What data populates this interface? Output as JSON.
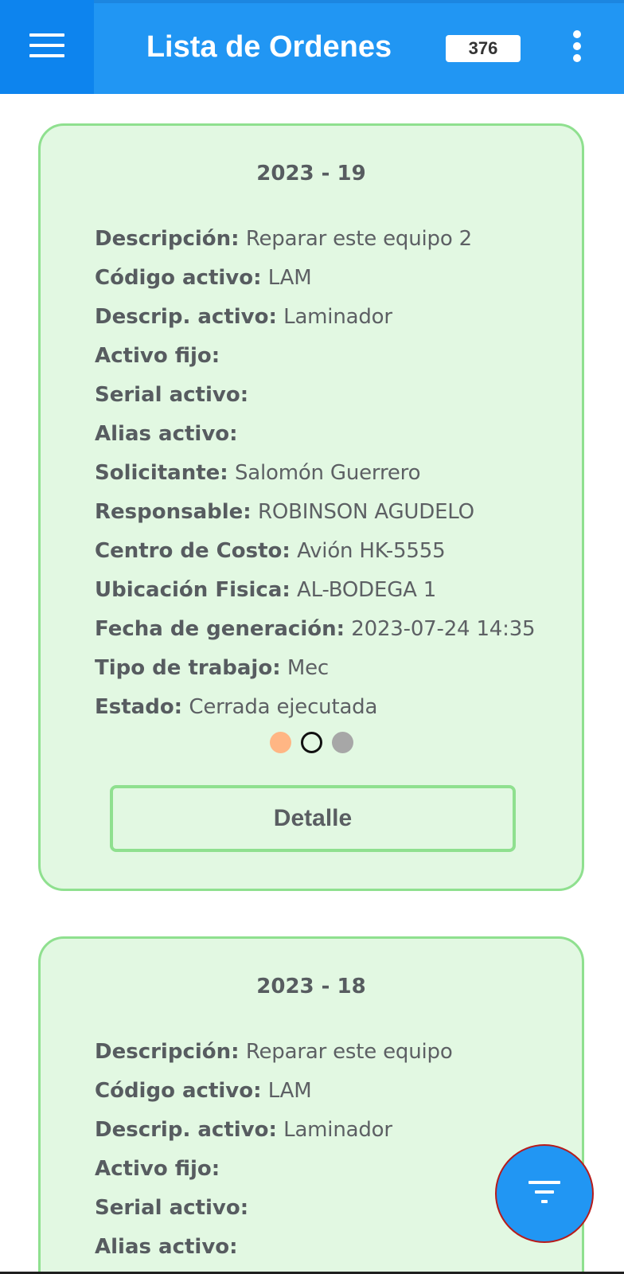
{
  "appbar": {
    "title": "Lista de Ordenes",
    "count": "376",
    "menu_icon": "hamburger-menu-icon",
    "more_icon": "more-vertical-icon",
    "color": "#2196f3"
  },
  "orders": [
    {
      "title": "2023 - 19",
      "fields": [
        {
          "label": "Descripción:",
          "value": "Reparar este equipo 2"
        },
        {
          "label": "Código activo:",
          "value": "LAM"
        },
        {
          "label": "Descrip. activo:",
          "value": "Laminador"
        },
        {
          "label": "Activo fijo:",
          "value": ""
        },
        {
          "label": "Serial activo:",
          "value": ""
        },
        {
          "label": "Alias activo:",
          "value": ""
        },
        {
          "label": "Solicitante:",
          "value": "Salomón Guerrero"
        },
        {
          "label": "Responsable:",
          "value": "ROBINSON AGUDELO"
        },
        {
          "label": "Centro de Costo:",
          "value": "Avión HK-5555"
        },
        {
          "label": "Ubicación Fisica:",
          "value": "AL-BODEGA 1"
        },
        {
          "label": "Fecha de generación:",
          "value": "2023-07-24 14:35"
        },
        {
          "label": "Tipo de trabajo:",
          "value": "Mec"
        },
        {
          "label": "Estado:",
          "value": "Cerrada ejecutada"
        }
      ],
      "status_dots": [
        "#ffb684",
        "outline",
        "#a7a7a7"
      ],
      "detail_label": "Detalle"
    },
    {
      "title": "2023 - 18",
      "fields": [
        {
          "label": "Descripción:",
          "value": "Reparar este equipo"
        },
        {
          "label": "Código activo:",
          "value": "LAM"
        },
        {
          "label": "Descrip. activo:",
          "value": "Laminador"
        },
        {
          "label": "Activo fijo:",
          "value": ""
        },
        {
          "label": "Serial activo:",
          "value": ""
        },
        {
          "label": "Alias activo:",
          "value": ""
        }
      ]
    }
  ],
  "fab": {
    "icon": "filter-icon",
    "color": "#2196f3"
  },
  "colors": {
    "card_background": "#e2f8e2",
    "card_border": "#8fe08f",
    "text": "#575c60"
  }
}
